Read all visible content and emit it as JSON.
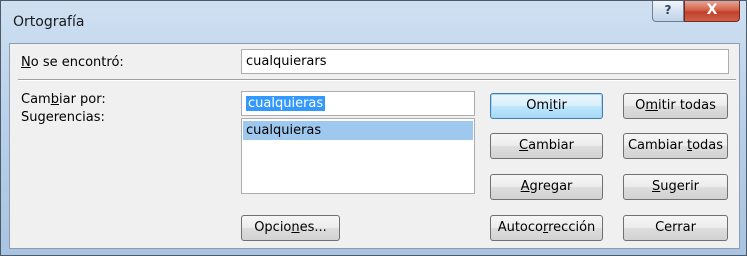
{
  "window": {
    "title": "Ortografía",
    "help_glyph": "?",
    "close_glyph": "X"
  },
  "not_found": {
    "label_pre": "",
    "label_accel": "N",
    "label_post": "o se encontró:",
    "value": "cualquierars"
  },
  "change_to": {
    "label_pre": "Cam",
    "label_accel": "b",
    "label_post": "iar por:",
    "value": "cualquieras"
  },
  "suggestions": {
    "label": "Sugerencias:",
    "items": [
      "cualquieras"
    ]
  },
  "buttons": {
    "ignore": {
      "pre": "Om",
      "accel": "i",
      "post": "tir"
    },
    "ignore_all": {
      "pre": "O",
      "accel": "m",
      "post": "itir todas"
    },
    "change": {
      "pre": "",
      "accel": "C",
      "post": "ambiar"
    },
    "change_all": {
      "pre": "Cambiar ",
      "accel": "t",
      "post": "odas"
    },
    "add": {
      "pre": "",
      "accel": "A",
      "post": "gregar"
    },
    "suggest": {
      "pre": "",
      "accel": "S",
      "post": "ugerir"
    },
    "options": {
      "pre": "Opcio",
      "accel": "n",
      "post": "es..."
    },
    "autocorrect": {
      "pre": "Autoco",
      "accel": "r",
      "post": "rección"
    },
    "close": {
      "pre": "Cerrar",
      "accel": "",
      "post": ""
    }
  }
}
